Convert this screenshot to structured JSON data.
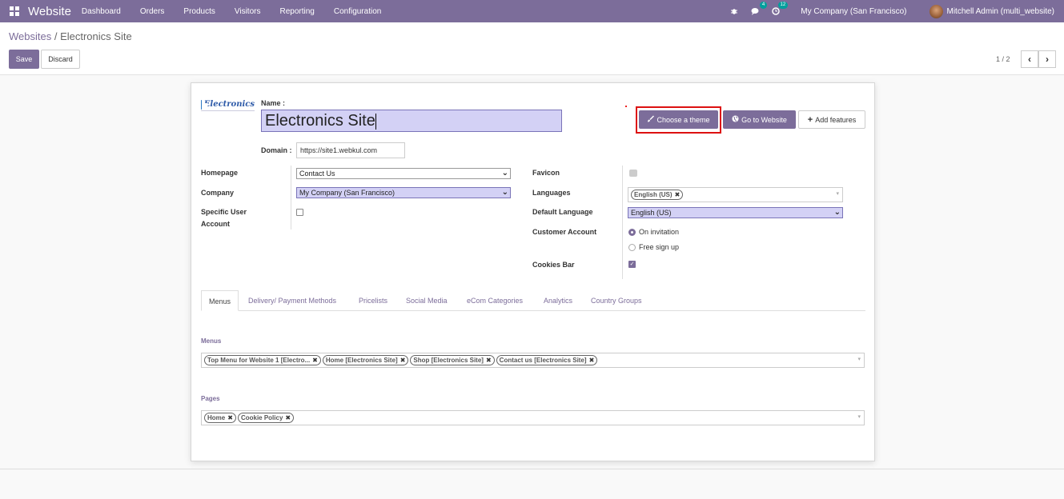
{
  "navbar": {
    "app_title": "Website",
    "menu": [
      "Dashboard",
      "Orders",
      "Products",
      "Visitors",
      "Reporting",
      "Configuration"
    ],
    "bug_icon": "bug-icon",
    "messages_count": "4",
    "activities_count": "12",
    "company": "My Company (San Francisco)",
    "user": "Mitchell Admin (multi_website)"
  },
  "breadcrumb": {
    "parent": "Websites",
    "separator": " / ",
    "current": "Electronics Site"
  },
  "actions": {
    "save": "Save",
    "discard": "Discard"
  },
  "pager": {
    "value": "1 / 2",
    "prev": "‹",
    "next": "›"
  },
  "form": {
    "logo_text": "Electronics",
    "name_label": "Name :",
    "name_value": "Electronics Site",
    "domain_label": "Domain :",
    "domain_value": "https://site1.webkul.com",
    "buttons": {
      "choose_theme": "Choose a theme",
      "go_to_website": "Go to Website",
      "add_features": "Add features"
    },
    "left": {
      "homepage_label": "Homepage",
      "homepage_value": "Contact Us",
      "company_label": "Company",
      "company_value": "My Company (San Francisco)",
      "specific_user_label": "Specific User",
      "specific_user_label2": "Account",
      "specific_user_checked": false
    },
    "right": {
      "favicon_label": "Favicon",
      "languages_label": "Languages",
      "languages": [
        "English (US)"
      ],
      "default_language_label": "Default Language",
      "default_language_value": "English (US)",
      "customer_account_label": "Customer Account",
      "customer_account_options": [
        "On invitation",
        "Free sign up"
      ],
      "customer_account_selected": "On invitation",
      "cookies_bar_label": "Cookies Bar",
      "cookies_bar_checked": true
    },
    "tabs": [
      "Menus",
      "Delivery/ Payment Methods",
      "Pricelists",
      "Social Media",
      "eCom Categories",
      "Analytics",
      "Country Groups"
    ],
    "active_tab": "Menus",
    "menus_label": "Menus",
    "menus": [
      "Top Menu for Website 1 [Electro...",
      "Home [Electronics Site]",
      "Shop [Electronics Site]",
      "Contact us [Electronics Site]"
    ],
    "pages_label": "Pages",
    "pages": [
      "Home",
      "Cookie Policy"
    ]
  },
  "colors": {
    "brand": "#7c6d9a",
    "highlight": "#d3d1f5",
    "annotation": "#d11111"
  }
}
